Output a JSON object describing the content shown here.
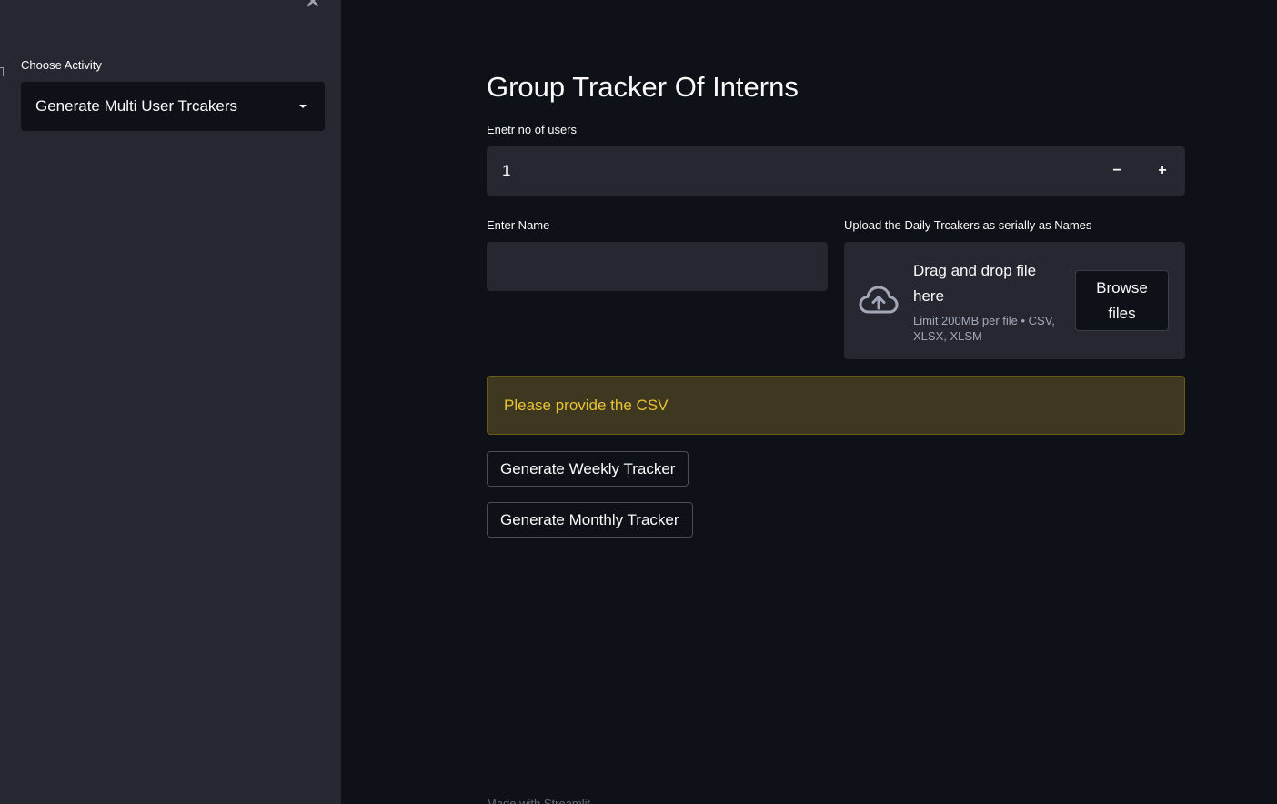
{
  "sidebar": {
    "close_icon": "close-icon",
    "activity_label": "Choose Activity",
    "activity_selected": "Generate Multi User Trcakers"
  },
  "main": {
    "title": "Group Tracker Of Interns",
    "users_label": "Enetr no of users",
    "users_value": "1",
    "decrement": "−",
    "increment": "+",
    "name_label": "Enter Name",
    "name_value": "",
    "upload_label": "Upload the Daily Trcakers as serially as Names",
    "upload_drop_text": "Drag and drop file here",
    "upload_limit": "Limit 200MB per file • CSV, XLSX, XLSM",
    "browse_label": "Browse files",
    "warning_text": "Please provide the CSV",
    "weekly_button": "Generate Weekly Tracker",
    "monthly_button": "Generate Monthly Tracker",
    "footer": "Made with Streamlit"
  },
  "colors": {
    "background": "#0e1117",
    "sidebar": "#262730",
    "input": "#262730",
    "warning_bg": "#3e3820",
    "warning_text": "#e7c233"
  }
}
